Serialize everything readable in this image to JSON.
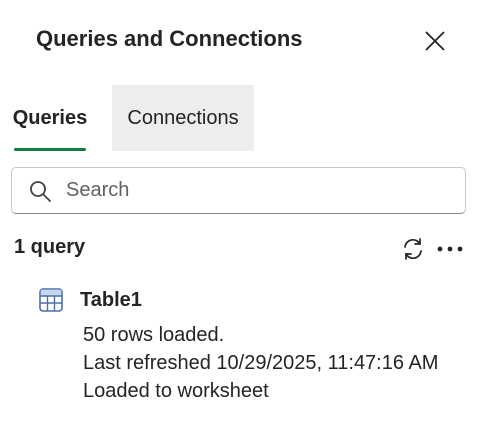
{
  "pane": {
    "title": "Queries and Connections"
  },
  "tabs": [
    {
      "label": "Queries",
      "selected": true
    },
    {
      "label": "Connections",
      "selected": false
    }
  ],
  "search": {
    "placeholder": "Search",
    "value": ""
  },
  "summary": {
    "count_label": "1 query"
  },
  "queries": [
    {
      "name": "Table1",
      "rows_status": "50 rows loaded.",
      "last_refreshed": "Last refreshed 10/29/2025, 11:47:16 AM",
      "load_target": "Loaded to worksheet"
    }
  ],
  "icons": {
    "close": "close-icon",
    "search": "search-icon",
    "refresh": "refresh-icon",
    "more": "more-icon",
    "table": "table-icon"
  },
  "colors": {
    "accent": "#107c41",
    "tab_hover_bg": "#ededeb",
    "text": "#242424",
    "table_icon": "#4a6fa5"
  }
}
